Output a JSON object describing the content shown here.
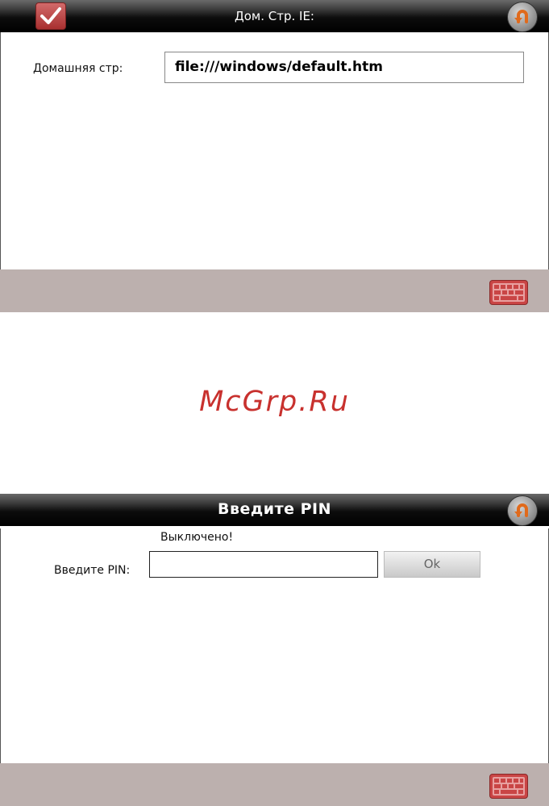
{
  "screen1": {
    "title": "Дом. Стр. IE:",
    "home_label": "Домашняя стр:",
    "home_value": "file:///windows/default.htm"
  },
  "watermark": "McGrp.Ru",
  "screen2": {
    "title": "Введите PIN",
    "status": "Выключено!",
    "pin_label": "Введите PIN:",
    "pin_value": "",
    "ok_label": "Ok"
  },
  "icons": {
    "confirm": "check-icon",
    "back": "back-arrow-icon",
    "keyboard": "keyboard-icon"
  },
  "colors": {
    "bottom_bar": "#bcb0ae",
    "accent_red": "#c94545",
    "watermark": "#c8312e"
  }
}
